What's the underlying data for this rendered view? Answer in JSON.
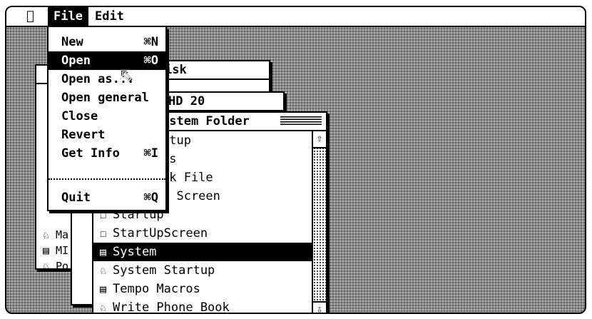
{
  "menubar": {
    "apple_icon": "apple-icon",
    "file_label": "File",
    "edit_label": "Edit"
  },
  "file_menu": {
    "items": [
      {
        "label": "New",
        "shortcut": "⌘N"
      },
      {
        "label": "Open",
        "shortcut": "⌘O"
      },
      {
        "label": "Open as...",
        "shortcut": ""
      },
      {
        "label": "Open general",
        "shortcut": ""
      },
      {
        "label": "Close",
        "shortcut": ""
      },
      {
        "label": "Revert",
        "shortcut": ""
      },
      {
        "label": "Get Info",
        "shortcut": "⌘I"
      },
      {
        "label": "Quit",
        "shortcut": "⌘Q"
      }
    ],
    "highlighted": "Open"
  },
  "windows": {
    "disk": {
      "title": "isk"
    },
    "hd20": {
      "title": "HD 20"
    },
    "system_folder": {
      "title": "ystem Folder",
      "hidden_rows": [
        "rtup",
        "ts",
        "ok File",
        "y Screen"
      ],
      "rows": [
        {
          "label": "Startup",
          "icon": "document-icon"
        },
        {
          "label": "StartUpScreen",
          "icon": "document-icon"
        },
        {
          "label": "System",
          "icon": "system-file-icon",
          "selected": true
        },
        {
          "label": "System Startup",
          "icon": "application-icon"
        },
        {
          "label": "Tempo Macros",
          "icon": "system-file-icon"
        },
        {
          "label": "Write Phone Book",
          "icon": "application-icon"
        }
      ]
    },
    "back_window": {
      "rows": [
        {
          "label": "Ma",
          "icon": "application-icon"
        },
        {
          "label": "MI",
          "icon": "system-file-icon"
        },
        {
          "label": "Po",
          "icon": "application-icon"
        }
      ]
    }
  }
}
